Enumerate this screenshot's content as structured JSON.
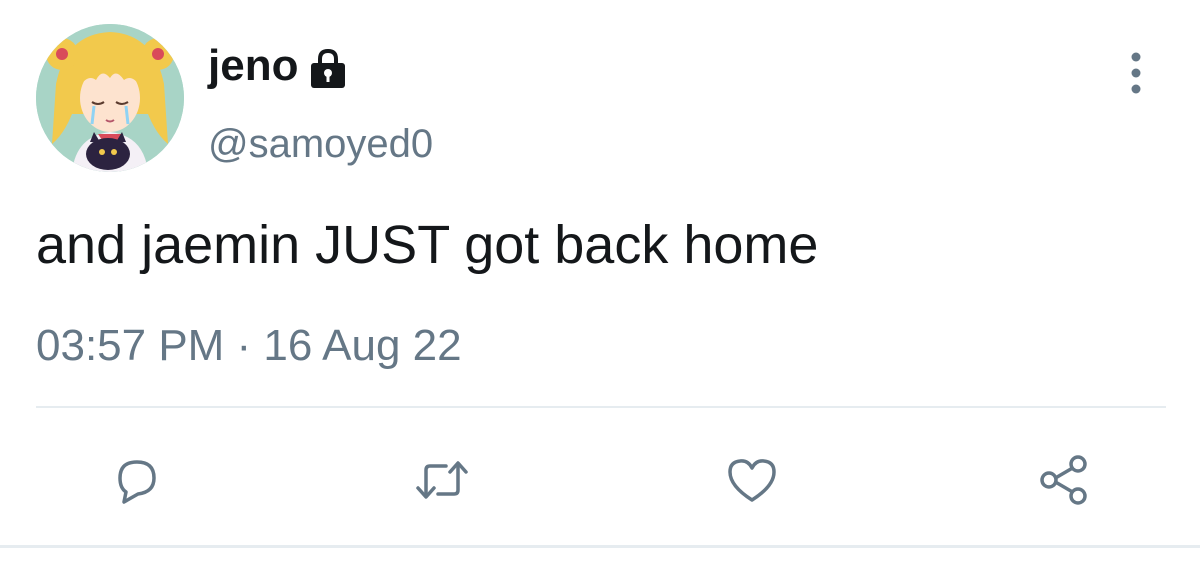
{
  "user": {
    "display_name": "jeno",
    "handle": "@samoyed0",
    "protected": true,
    "avatar_icon": "anime-avatar"
  },
  "tweet": {
    "text": "and jaemin JUST got back home",
    "timestamp": "03:57 PM · 16 Aug 22"
  },
  "actions": {
    "reply_icon": "reply-icon",
    "retweet_icon": "retweet-icon",
    "like_icon": "heart-icon",
    "share_icon": "share-icon",
    "more_icon": "more-vertical-icon"
  },
  "colors": {
    "text_primary": "#14171a",
    "text_secondary": "#657786",
    "icon": "#657786",
    "divider": "#e6ecf0"
  }
}
